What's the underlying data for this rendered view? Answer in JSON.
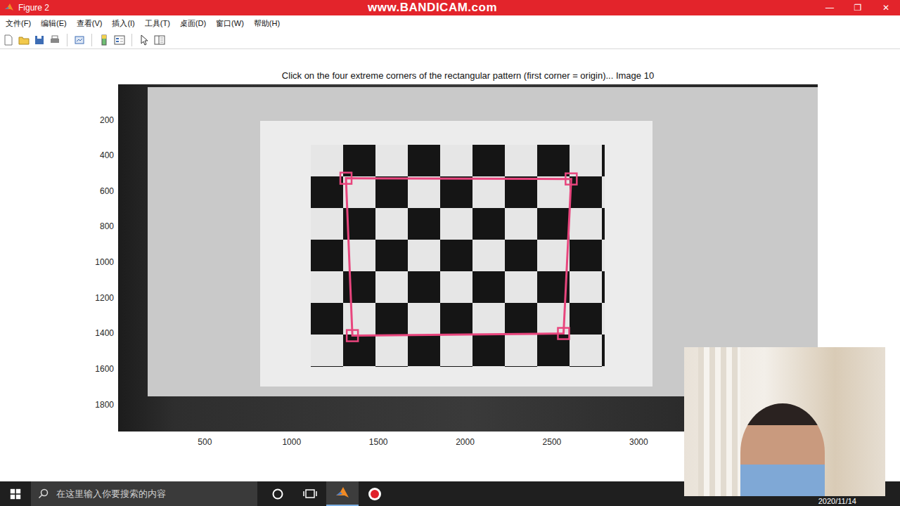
{
  "window": {
    "title": "Figure 2",
    "watermark": "www.BANDICAM.com",
    "controls": [
      "—",
      "❐",
      "✕"
    ]
  },
  "menu": [
    "文件(F)",
    "编辑(E)",
    "查看(V)",
    "插入(I)",
    "工具(T)",
    "桌面(D)",
    "窗口(W)",
    "帮助(H)"
  ],
  "plot": {
    "title": "Click on the four extreme corners of the rectangular pattern (first corner = origin)... Image 10",
    "x_ticks": [
      "500",
      "1000",
      "1500",
      "2000",
      "2500",
      "3000"
    ],
    "y_ticks": [
      "200",
      "400",
      "600",
      "800",
      "1000",
      "1200",
      "1400",
      "1600",
      "1800"
    ],
    "clicked_points": [
      {
        "x": 1313,
        "y": 528
      },
      {
        "x": 2611,
        "y": 532
      },
      {
        "x": 2567,
        "y": 1401
      },
      {
        "x": 1350,
        "y": 1413
      }
    ]
  },
  "taskbar": {
    "search_placeholder": "在这里输入你要搜索的内容",
    "clock": "2020/11/14",
    "apps": [
      {
        "kind": "cortana",
        "active": false
      },
      {
        "kind": "taskview",
        "active": false
      },
      {
        "kind": "matlab",
        "active": true
      },
      {
        "kind": "record",
        "active": false
      }
    ]
  }
}
